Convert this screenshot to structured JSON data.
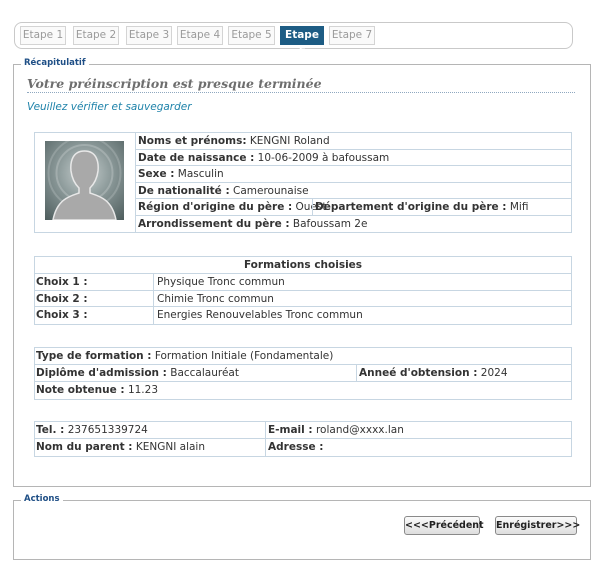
{
  "steps": [
    {
      "label": "Etape 1",
      "active": false
    },
    {
      "label": "Etape 2",
      "active": false
    },
    {
      "label": "Etape 3",
      "active": false
    },
    {
      "label": "Etape 4",
      "active": false
    },
    {
      "label": "Etape 5",
      "active": false
    },
    {
      "label": "Etape 6",
      "active": true
    },
    {
      "label": "Etape 7",
      "active": false
    }
  ],
  "recap": {
    "legend": "Récapitulatif",
    "title": "Votre préinscription est presque terminée",
    "subtitle": "Veuillez vérifier et sauvegarder",
    "avatar_icon": "person-silhouette-icon"
  },
  "identity": {
    "name_label": "Noms et prénoms:",
    "name_value": "KENGNI Roland",
    "dob_label": "Date de naissance :",
    "dob_value": "10-06-2009 à bafoussam",
    "sex_label": "Sexe :",
    "sex_value": "Masculin",
    "nat_label": "De nationalité :",
    "nat_value": "Camerounaise",
    "region_label": "Région d'origine du père :",
    "region_value": "Ouest",
    "dept_label": "Département d'origine du père :",
    "dept_value": "Mifi",
    "arr_label": "Arrondissement du père :",
    "arr_value": "Bafoussam 2e"
  },
  "formations": {
    "header": "Formations choisies",
    "choices": [
      {
        "label": "Choix 1 :",
        "value": "Physique Tronc commun"
      },
      {
        "label": "Choix 2 :",
        "value": "Chimie Tronc commun"
      },
      {
        "label": "Choix 3 :",
        "value": "Energies Renouvelables Tronc commun"
      }
    ]
  },
  "training": {
    "type_label": "Type de formation :",
    "type_value": "Formation Initiale (Fondamentale)",
    "diploma_label": "Diplôme d'admission :",
    "diploma_value": "Baccalauréat",
    "year_label": "Anneé d'obtension :",
    "year_value": "2024",
    "grade_label": "Note obtenue :",
    "grade_value": "11.23"
  },
  "contact": {
    "tel_label": "Tel. :",
    "tel_value": "237651339724",
    "email_label": "E-mail :",
    "email_value": "roland@xxxx.lan",
    "parent_label": "Nom du parent :",
    "parent_value": "KENGNI alain",
    "address_label": "Adresse :",
    "address_value": ""
  },
  "actions": {
    "legend": "Actions",
    "prev_label": "<<<Précédent",
    "save_label": "Enrégistrer>>>"
  },
  "colors": {
    "active_step": "#1d5c84",
    "legend": "#1f4f86",
    "subtitle": "#1f83aa",
    "table_border": "#c7d6e2"
  }
}
